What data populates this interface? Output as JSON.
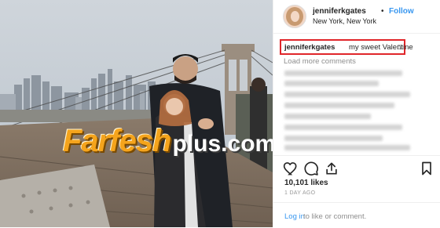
{
  "post": {
    "username": "jenniferkgates",
    "follow_separator": "•",
    "follow_label": "Follow",
    "location": "New York, New York",
    "caption": {
      "username": "jenniferkgates",
      "text": "my sweet Valentine",
      "emoji": "□"
    },
    "load_more_label": "Load more comments",
    "likes_text": "10,101 likes",
    "time_text": "1 DAY AGO",
    "login_link": "Log in",
    "login_rest": "to like or comment."
  },
  "watermark": {
    "brand": "Farfesh",
    "suffix": "plus.com"
  },
  "icons": {
    "like": "heart-icon",
    "comment": "comment-icon",
    "share": "share-icon",
    "save": "bookmark-icon"
  },
  "colors": {
    "link_blue": "#3897f0",
    "caption_highlight": "#e0262a",
    "watermark_orange": "#f5a41c"
  }
}
